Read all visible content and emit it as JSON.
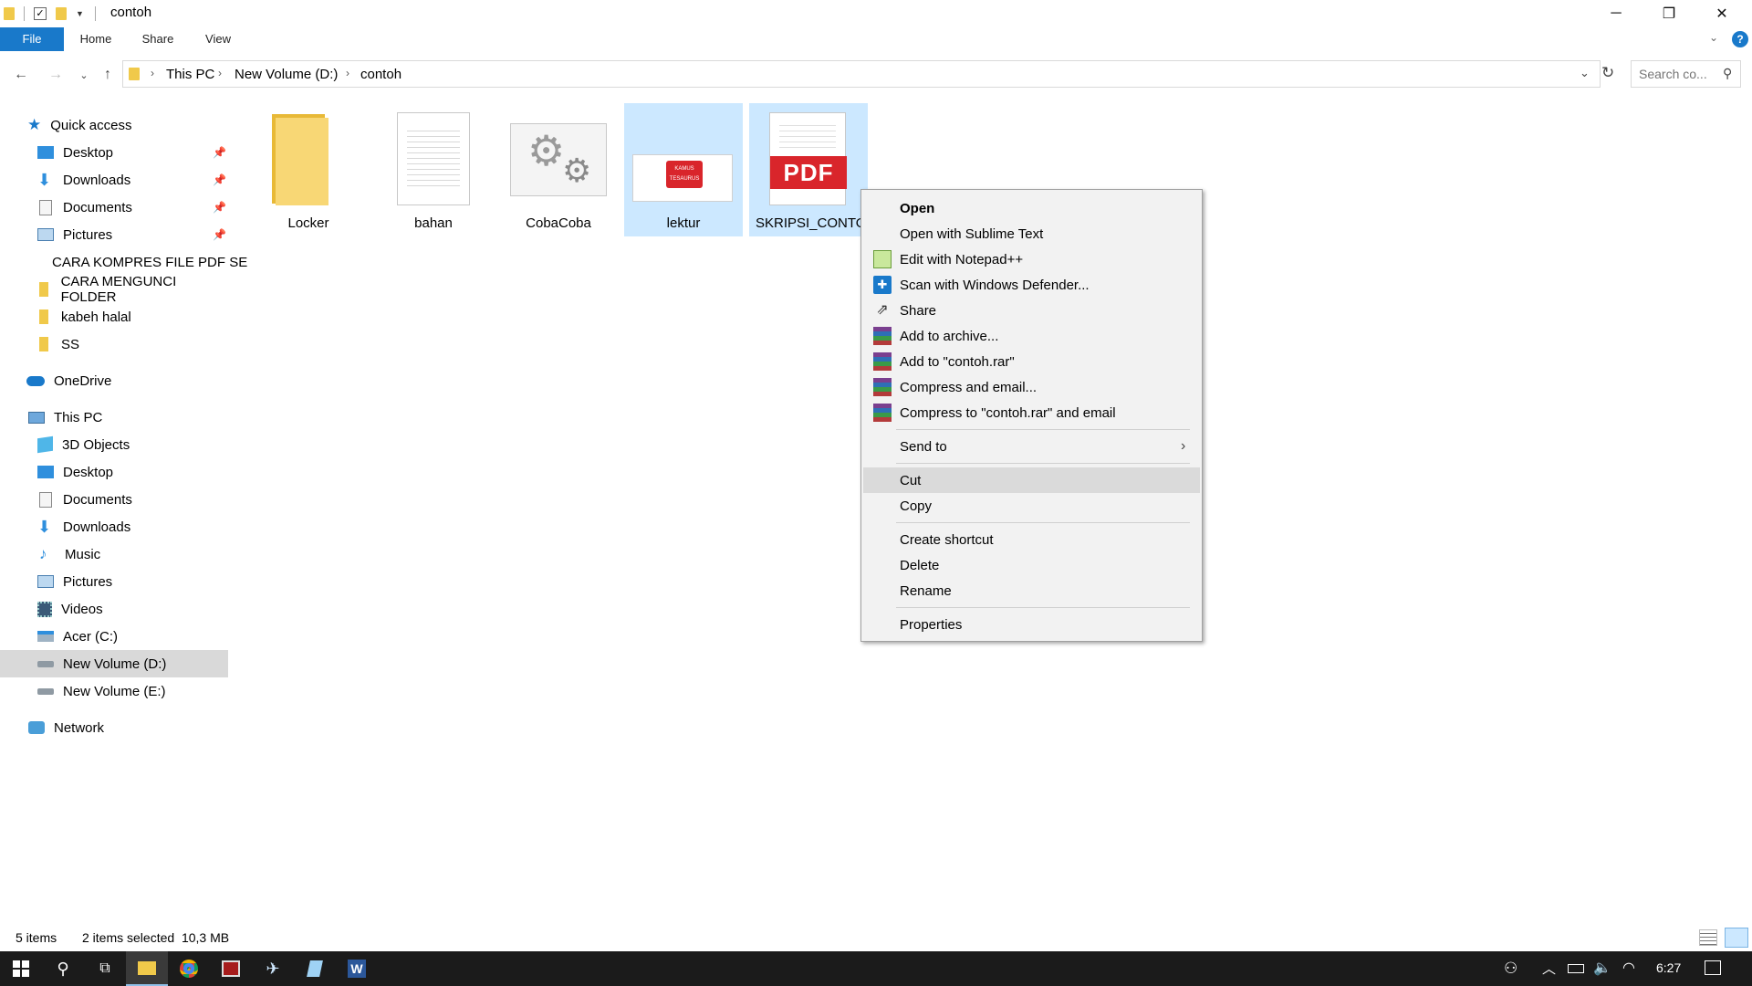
{
  "window": {
    "title": "contoh",
    "minimize": "─",
    "restore": "❐",
    "close": "✕"
  },
  "ribbon": {
    "tabs": [
      "File",
      "Home",
      "Share",
      "View"
    ]
  },
  "address": {
    "crumbs": [
      "This PC",
      "New Volume (D:)",
      "contoh"
    ],
    "search_placeholder": "Search co..."
  },
  "sidebar": {
    "quick_access": "Quick access",
    "quick_items": [
      "Desktop",
      "Downloads",
      "Documents",
      "Pictures",
      "CARA KOMPRES FILE PDF SE",
      "CARA MENGUNCI FOLDER",
      "kabeh halal",
      "SS"
    ],
    "onedrive": "OneDrive",
    "this_pc": "This PC",
    "pc_items": [
      "3D Objects",
      "Desktop",
      "Documents",
      "Downloads",
      "Music",
      "Pictures",
      "Videos",
      "Acer (C:)",
      "New Volume (D:)",
      "New Volume (E:)"
    ],
    "network": "Network"
  },
  "files": [
    {
      "name": "Locker",
      "type": "folder"
    },
    {
      "name": "bahan",
      "type": "text"
    },
    {
      "name": "CobaCoba",
      "type": "settings"
    },
    {
      "name": "lektur",
      "type": "image"
    },
    {
      "name": "SKRIPSI_CONTOH",
      "type": "pdf"
    }
  ],
  "thumb_text": {
    "pdf": "PDF",
    "lektur_top": "KAMUS",
    "lektur_bottom": "TESAURUS"
  },
  "context_menu": {
    "items": [
      "Open",
      "Open with Sublime Text",
      "Edit with Notepad++",
      "Scan with Windows Defender...",
      "Share",
      "Add to archive...",
      "Add to \"contoh.rar\"",
      "Compress and email...",
      "Compress to \"contoh.rar\" and email",
      "Send to",
      "Cut",
      "Copy",
      "Create shortcut",
      "Delete",
      "Rename",
      "Properties"
    ]
  },
  "status": {
    "count": "5 items",
    "selection": "2 items selected  10,3 MB"
  },
  "taskbar": {
    "time": "6:27"
  },
  "colors": {
    "accent": "#1979ca",
    "selection": "#cce8ff",
    "folder": "#f8d775",
    "pdf_red": "#d9252b"
  }
}
